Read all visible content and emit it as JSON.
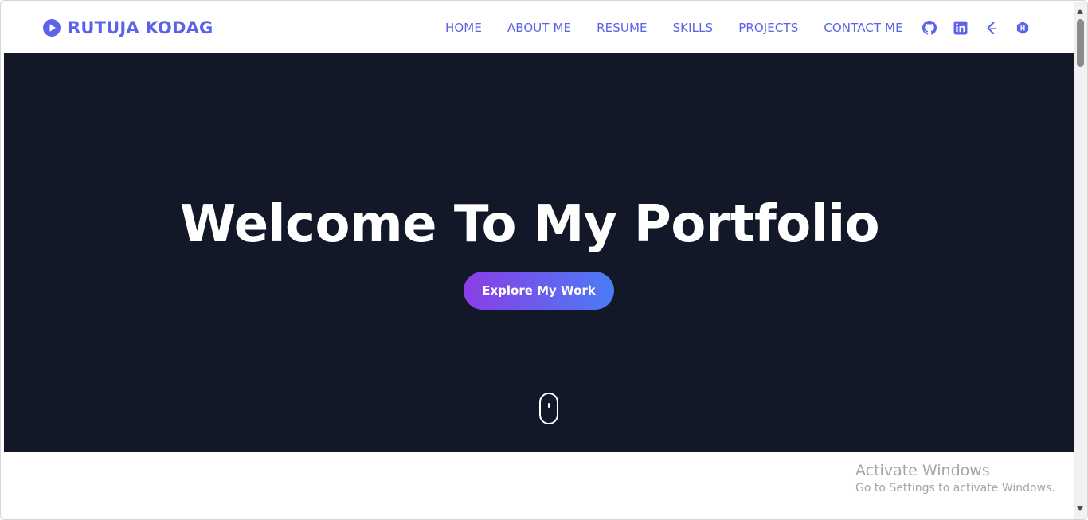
{
  "brand": {
    "name": "RUTUJA KODAG",
    "icon": "play-circle-icon",
    "color": "#5b63e8"
  },
  "nav": {
    "links": [
      {
        "label": "HOME"
      },
      {
        "label": "ABOUT ME"
      },
      {
        "label": "RESUME"
      },
      {
        "label": "SKILLS"
      },
      {
        "label": "PROJECTS"
      },
      {
        "label": "CONTACT ME"
      }
    ],
    "icons": [
      "github-icon",
      "linkedin-icon",
      "leetcode-icon",
      "hackerrank-icon"
    ]
  },
  "hero": {
    "title": "Welcome To My Portfolio",
    "button_label": "Explore My Work",
    "background": "#121827",
    "button_gradient": [
      "#8a3de6",
      "#4b7cf5"
    ]
  },
  "watermark": {
    "title": "Activate Windows",
    "subtitle": "Go to Settings to activate Windows."
  }
}
